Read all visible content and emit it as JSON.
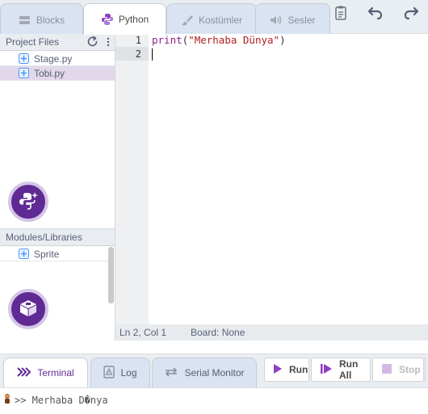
{
  "tabs": {
    "blocks": "Blocks",
    "python": "Python",
    "costumes": "Kostümler",
    "sounds": "Sesler"
  },
  "left_panel": {
    "files_header": "Project Files",
    "files": [
      "Stage.py",
      "Tobi.py"
    ],
    "modules_header": "Modules/Libraries",
    "modules": [
      "Sprite"
    ]
  },
  "editor": {
    "line_numbers": [
      "1",
      "2"
    ],
    "code": {
      "keyword": "print",
      "open": "(",
      "string": "\"Merhaba Dünya\"",
      "close": ")"
    }
  },
  "status": {
    "position": "Ln 2, Col 1",
    "board": "Board: None"
  },
  "bottom_tabs": {
    "terminal": "Terminal",
    "log": "Log",
    "serial": "Serial Monitor"
  },
  "controls": {
    "run": "Run",
    "run_all": "Run All",
    "stop": "Stop"
  },
  "terminal": {
    "output": ">> Merhaba D�nya"
  },
  "colors": {
    "accent": "#5f2a93",
    "accent_light": "#d5c6e6",
    "selected_file": "#e3d8ea"
  },
  "icons": {
    "blocks": "blocks-icon",
    "python": "python-icon",
    "costumes": "brush-icon",
    "sounds": "speaker-icon",
    "clipboard": "clipboard-icon",
    "undo": "undo-icon",
    "redo": "redo-icon",
    "refresh": "refresh-icon",
    "more": "more-vertical-icon",
    "file": "python-file-icon",
    "add_python": "python-sparkle-icon",
    "add_library": "package-icon",
    "terminal": "chevrons-right-icon",
    "log": "log-icon",
    "serial": "arrows-horizontal-icon",
    "run": "play-icon",
    "run_all": "play-all-icon",
    "stop": "stop-icon"
  }
}
